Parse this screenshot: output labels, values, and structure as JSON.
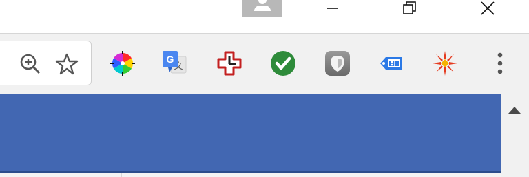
{
  "window": {
    "profile_icon": "person-icon",
    "controls": [
      "minimize-icon",
      "restore-icon",
      "close-icon"
    ]
  },
  "toolbar": {
    "omnibox_icons": [
      "zoom-in-icon",
      "bookmark-star-icon"
    ],
    "extensions": [
      "color-wheel-icon",
      "google-translate-icon",
      "clock-cross-icon",
      "green-checkmark-icon",
      "shield-icon",
      "tag-icon",
      "red-starburst-icon"
    ],
    "menu_icon": "kebab-menu-icon"
  },
  "content": {
    "background_color": "#4267b2"
  },
  "scrollbar": {
    "up_icon": "scroll-up-arrow-icon"
  }
}
